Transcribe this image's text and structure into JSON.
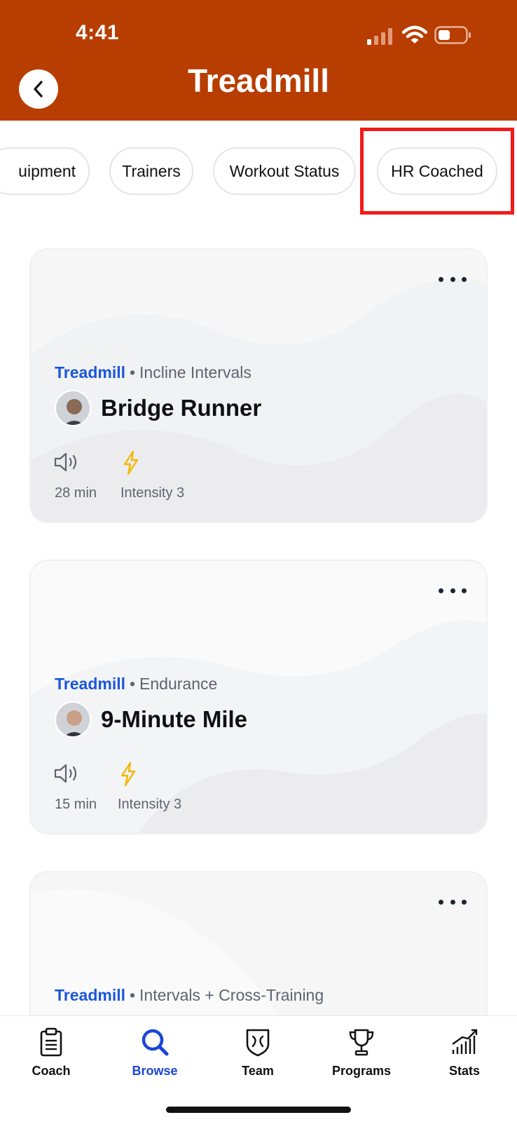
{
  "status_bar": {
    "time": "4:41"
  },
  "header": {
    "title": "Treadmill"
  },
  "filters": [
    {
      "label": "uipment"
    },
    {
      "label": "Trainers"
    },
    {
      "label": "Workout Status"
    },
    {
      "label": "HR Coached"
    }
  ],
  "cards": [
    {
      "brand": "Treadmill",
      "separator": "•",
      "category": "Incline Intervals",
      "title": "Bridge Runner",
      "duration": "28 min",
      "intensity": "Intensity 3"
    },
    {
      "brand": "Treadmill",
      "separator": "•",
      "category": "Endurance",
      "title": "9-Minute Mile",
      "duration": "15 min",
      "intensity": "Intensity 3"
    },
    {
      "brand": "Treadmill",
      "separator": "•",
      "category": "Intervals + Cross-Training"
    }
  ],
  "nav": [
    {
      "label": "Coach",
      "icon": "clipboard-icon"
    },
    {
      "label": "Browse",
      "icon": "search-icon",
      "active": true
    },
    {
      "label": "Team",
      "icon": "shield-icon"
    },
    {
      "label": "Programs",
      "icon": "trophy-icon"
    },
    {
      "label": "Stats",
      "icon": "bar-chart-icon"
    }
  ],
  "colors": {
    "header": "#b83d00",
    "accent": "#1a57d9",
    "active_nav": "#1a44d9",
    "intensity_bolt": "#f2b705",
    "highlight": "#f21b1b"
  }
}
